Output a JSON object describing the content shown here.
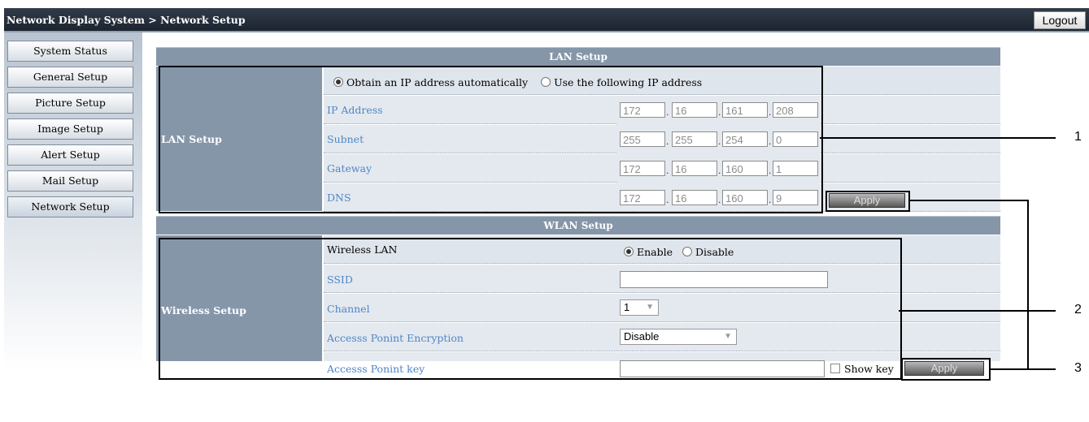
{
  "header": {
    "breadcrumb": "Network Display System > Network Setup",
    "logout_label": "Logout"
  },
  "sidebar": {
    "items": [
      {
        "label": "System Status"
      },
      {
        "label": "General Setup"
      },
      {
        "label": "Picture Setup"
      },
      {
        "label": "Image Setup"
      },
      {
        "label": "Alert Setup"
      },
      {
        "label": "Mail Setup"
      },
      {
        "label": "Network Setup"
      }
    ],
    "active": "Network Setup"
  },
  "lan": {
    "section_title": "LAN Setup",
    "group_label": "LAN Setup",
    "radio_auto": "Obtain an IP address automatically",
    "radio_manual": "Use the following IP address",
    "selected": "auto",
    "rows": [
      {
        "label": "IP Address",
        "octets": [
          "172",
          "16",
          "161",
          "208"
        ]
      },
      {
        "label": "Subnet",
        "octets": [
          "255",
          "255",
          "254",
          "0"
        ]
      },
      {
        "label": "Gateway",
        "octets": [
          "172",
          "16",
          "160",
          "1"
        ]
      },
      {
        "label": "DNS",
        "octets": [
          "172",
          "16",
          "160",
          "9"
        ]
      }
    ],
    "apply_label": "Apply"
  },
  "wlan": {
    "section_title": "WLAN Setup",
    "group_label": "Wireless Setup",
    "wireless_lan_label": "Wireless LAN",
    "enable_label": "Enable",
    "disable_label": "Disable",
    "selected": "enable",
    "ssid_label": "SSID",
    "ssid_value": "",
    "channel_label": "Channel",
    "channel_value": "1",
    "encryption_label": "Accesss Ponint Encryption",
    "encryption_value": "Disable",
    "key_label": "Accesss Ponint key",
    "key_value": "",
    "show_key_label": "Show key",
    "apply_label": "Apply"
  },
  "callouts": [
    "1",
    "2",
    "3"
  ]
}
